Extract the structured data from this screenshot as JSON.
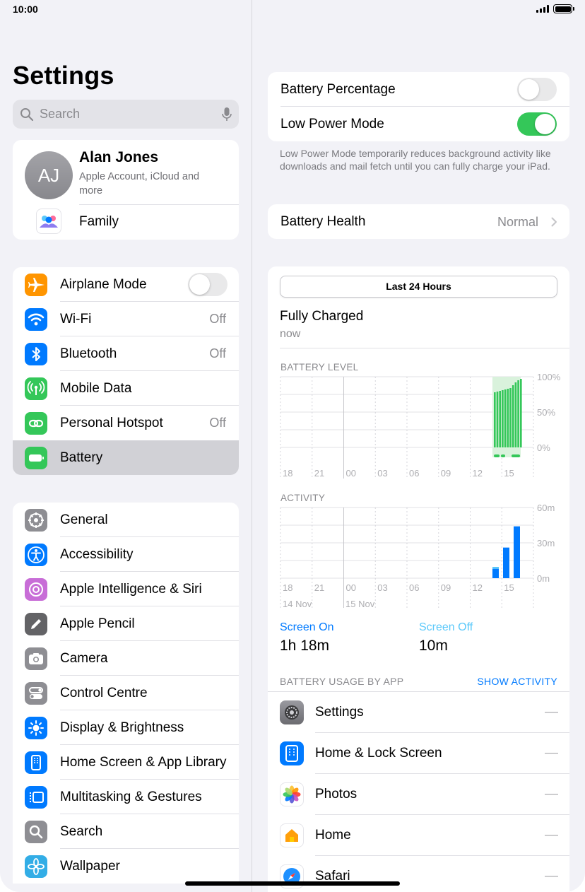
{
  "status": {
    "time": "10:00"
  },
  "sidebar": {
    "title": "Settings",
    "search_placeholder": "Search",
    "profile": {
      "initials": "AJ",
      "name": "Alan Jones",
      "subtitle": "Apple Account, iCloud and more",
      "family_label": "Family"
    },
    "group1": [
      {
        "label": "Airplane Mode",
        "icon": "airplane-icon",
        "color": "#ff9500",
        "toggle": false
      },
      {
        "label": "Wi-Fi",
        "icon": "wifi-icon",
        "color": "#007aff",
        "value": "Off"
      },
      {
        "label": "Bluetooth",
        "icon": "bluetooth-icon",
        "color": "#007aff",
        "value": "Off"
      },
      {
        "label": "Mobile Data",
        "icon": "antenna-icon",
        "color": "#34c759"
      },
      {
        "label": "Personal Hotspot",
        "icon": "link-icon",
        "color": "#34c759",
        "value": "Off"
      },
      {
        "label": "Battery",
        "icon": "battery-icon",
        "color": "#34c759",
        "selected": true
      }
    ],
    "group2": [
      {
        "label": "General",
        "icon": "gear-icon",
        "color": "#8e8e93"
      },
      {
        "label": "Accessibility",
        "icon": "accessibility-icon",
        "color": "#007aff"
      },
      {
        "label": "Apple Intelligence & Siri",
        "icon": "siri-icon",
        "color": "#c86dd7"
      },
      {
        "label": "Apple Pencil",
        "icon": "pencil-icon",
        "color": "#636366"
      },
      {
        "label": "Camera",
        "icon": "camera-icon",
        "color": "#8e8e93"
      },
      {
        "label": "Control Centre",
        "icon": "switches-icon",
        "color": "#8e8e93"
      },
      {
        "label": "Display & Brightness",
        "icon": "sun-icon",
        "color": "#007aff"
      },
      {
        "label": "Home Screen & App Library",
        "icon": "home-screen-icon",
        "color": "#007aff"
      },
      {
        "label": "Multitasking & Gestures",
        "icon": "multitasking-icon",
        "color": "#007aff"
      },
      {
        "label": "Search",
        "icon": "search-icon",
        "color": "#8e8e93"
      },
      {
        "label": "Wallpaper",
        "icon": "flower-icon",
        "color": "#32ade6"
      }
    ]
  },
  "detail": {
    "battery_percentage_label": "Battery Percentage",
    "battery_percentage_on": false,
    "low_power_label": "Low Power Mode",
    "low_power_on": true,
    "low_power_note": "Low Power Mode temporarily reduces background activity like downloads and mail fetch until you can fully charge your iPad.",
    "health_label": "Battery Health",
    "health_value": "Normal",
    "segment_label": "Last 24 Hours",
    "charge_status": "Fully Charged",
    "charge_time": "now",
    "level_caption": "BATTERY LEVEL",
    "activity_caption": "ACTIVITY",
    "screen_on_label": "Screen On",
    "screen_on_value": "1h 18m",
    "screen_off_label": "Screen Off",
    "screen_off_value": "10m",
    "usage_caption": "BATTERY USAGE BY APP",
    "show_activity": "SHOW ACTIVITY",
    "apps": [
      {
        "name": "Settings",
        "value": "—",
        "icon": "settings-app-icon"
      },
      {
        "name": "Home & Lock Screen",
        "value": "—",
        "icon": "home-lock-screen-icon"
      },
      {
        "name": "Photos",
        "value": "—",
        "icon": "photos-icon"
      },
      {
        "name": "Home",
        "value": "—",
        "icon": "home-app-icon"
      },
      {
        "name": "Safari",
        "value": "—",
        "icon": "safari-icon"
      }
    ],
    "colors": {
      "green": "#34c759",
      "blue": "#007aff",
      "light_blue": "#5ac8fa"
    }
  },
  "chart_data": [
    {
      "type": "bar",
      "title": "BATTERY LEVEL",
      "x_ticks": [
        "18",
        "21",
        "00",
        "03",
        "06",
        "09",
        "12",
        "15"
      ],
      "y_ticks": [
        "100%",
        "50%",
        "0%"
      ],
      "ylim": [
        0,
        100
      ],
      "series": [
        {
          "values": [
            78,
            79,
            80,
            81,
            82,
            83,
            84,
            88,
            92,
            95,
            97
          ]
        }
      ]
    },
    {
      "type": "bar",
      "title": "ACTIVITY",
      "x_ticks": [
        "18",
        "21",
        "00",
        "03",
        "06",
        "09",
        "12",
        "15"
      ],
      "x_date_labels": [
        "14 Nov",
        "15 Nov"
      ],
      "y_ticks": [
        "60m",
        "30m",
        "0m"
      ],
      "ylim": [
        0,
        60
      ],
      "series": [
        {
          "name": "Screen On",
          "values": [
            8,
            26,
            44
          ]
        },
        {
          "name": "Screen Off",
          "values": [
            1,
            0,
            0
          ]
        }
      ]
    }
  ]
}
